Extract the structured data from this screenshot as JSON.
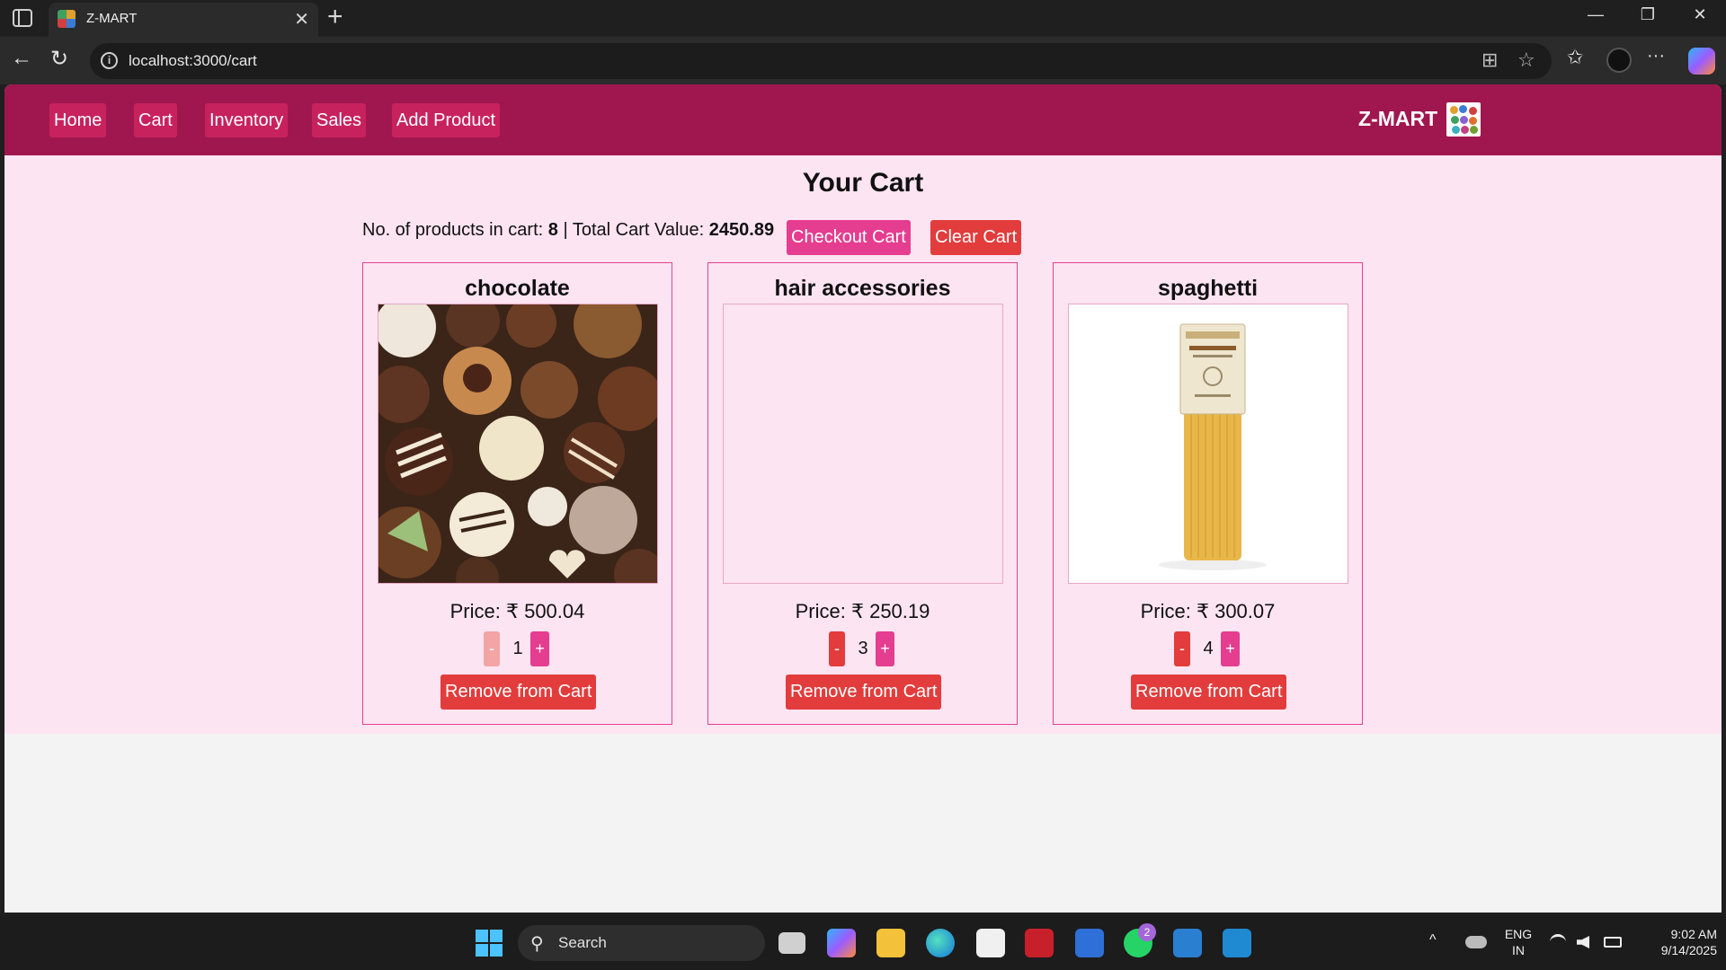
{
  "browser": {
    "tab_title": "Z-MART",
    "url": "localhost:3000/cart",
    "close_glyph": "✕",
    "new_tab_glyph": "+",
    "back_glyph": "←",
    "reload_glyph": "↻",
    "minimize_glyph": "—",
    "restore_glyph": "❐",
    "window_close_glyph": "✕",
    "split_glyph": "⊞",
    "star_glyph": "☆",
    "favorites_glyph": "✩",
    "more_glyph": "···"
  },
  "header": {
    "nav_items": [
      {
        "label": "Home"
      },
      {
        "label": "Cart"
      },
      {
        "label": "Inventory"
      },
      {
        "label": "Sales"
      },
      {
        "label": "Add Product"
      }
    ],
    "brand": "Z-MART"
  },
  "cart": {
    "title": "Your Cart",
    "count_label": "No. of products in cart:",
    "count": "8",
    "separator": "|",
    "total_label": "Total Cart Value:",
    "total": "2450.89",
    "checkout_label": "Checkout Cart",
    "clear_label": "Clear Cart",
    "products": [
      {
        "name": "chocolate",
        "price": "Price: ₹ 500.04",
        "qty": "1",
        "minus": "-",
        "plus": "+",
        "remove": "Remove from Cart",
        "image": "chocolates-photo"
      },
      {
        "name": "hair accessories",
        "price": "Price: ₹ 250.19",
        "qty": "3",
        "minus": "-",
        "plus": "+",
        "remove": "Remove from Cart",
        "image": "empty"
      },
      {
        "name": "spaghetti",
        "price": "Price: ₹ 300.07",
        "qty": "4",
        "minus": "-",
        "plus": "+",
        "remove": "Remove from Cart",
        "image": "spaghetti-package-photo"
      }
    ]
  },
  "taskbar": {
    "search_label": "Search",
    "search_glyph": "⚲",
    "lang_top": "ENG",
    "lang_bottom": "IN",
    "time": "9:02 AM",
    "date": "9/14/2025",
    "whatsapp_badge": "2",
    "chevron_glyph": "^"
  },
  "colors": {
    "header": "#a0174f",
    "page_bg": "#fde4f2",
    "accent_pink": "#e53d8f",
    "accent_red": "#e23c3c"
  }
}
